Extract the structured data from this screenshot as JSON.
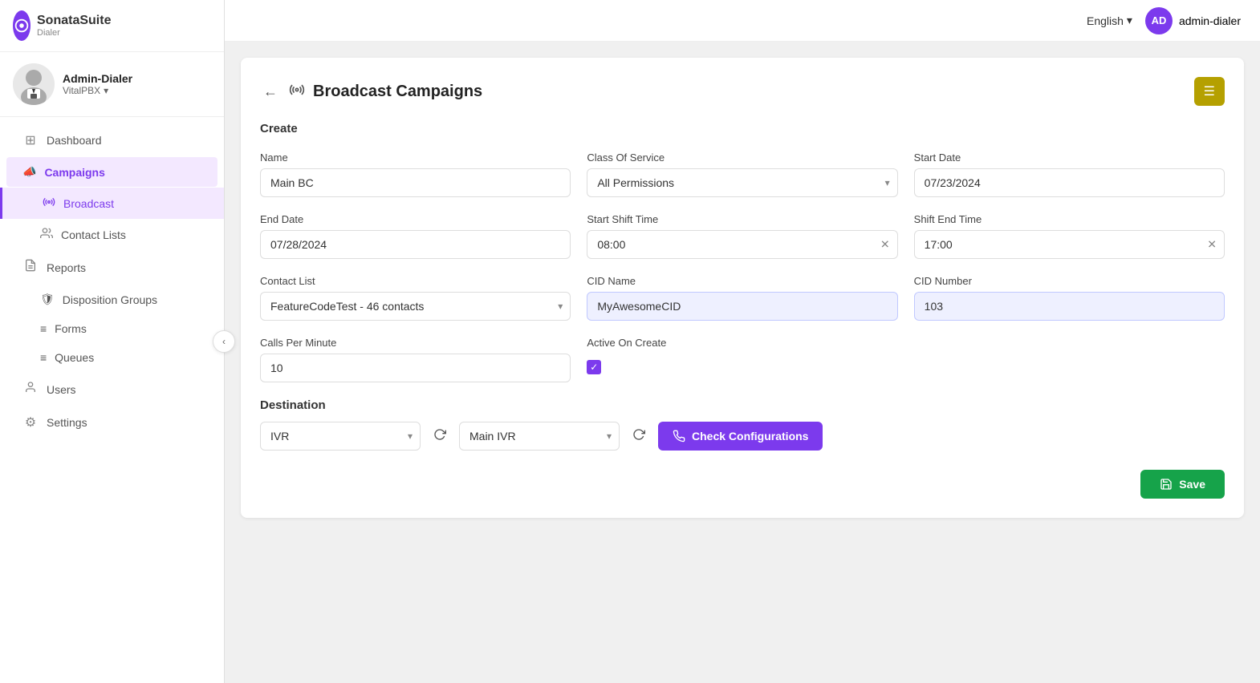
{
  "topbar": {
    "language": "English",
    "user_initials": "AD",
    "user_name": "admin-dialer"
  },
  "sidebar": {
    "logo_text": "SonataSuite",
    "logo_sub": "Dialer",
    "user_name": "Admin-Dialer",
    "user_org": "VitalPBX",
    "nav_items": [
      {
        "id": "dashboard",
        "label": "Dashboard",
        "icon": "⊞"
      },
      {
        "id": "campaigns",
        "label": "Campaigns",
        "icon": "📣",
        "active": true
      },
      {
        "id": "broadcast",
        "label": "Broadcast",
        "icon": "📡",
        "sub": true,
        "active_sub": true
      },
      {
        "id": "contact-lists",
        "label": "Contact Lists",
        "icon": "👥",
        "sub": true
      },
      {
        "id": "reports",
        "label": "Reports",
        "icon": "📄"
      },
      {
        "id": "disposition-groups",
        "label": "Disposition Groups",
        "icon": "🛡",
        "sub": true
      },
      {
        "id": "forms",
        "label": "Forms",
        "icon": "≡",
        "sub": true
      },
      {
        "id": "queues",
        "label": "Queues",
        "icon": "≡",
        "sub": true
      },
      {
        "id": "users",
        "label": "Users",
        "icon": "👤"
      },
      {
        "id": "settings",
        "label": "Settings",
        "icon": "⚙"
      }
    ]
  },
  "page": {
    "title": "Broadcast Campaigns",
    "section_label": "Create",
    "form": {
      "name_label": "Name",
      "name_value": "Main BC",
      "class_of_service_label": "Class Of Service",
      "class_of_service_value": "All Permissions",
      "start_date_label": "Start Date",
      "start_date_value": "07/23/2024",
      "end_date_label": "End Date",
      "end_date_value": "07/28/2024",
      "start_shift_time_label": "Start Shift Time",
      "start_shift_time_value": "08:00",
      "shift_end_time_label": "Shift End Time",
      "shift_end_time_value": "17:00",
      "contact_list_label": "Contact List",
      "contact_list_value": "FeatureCodeTest - 46 contacts",
      "cid_name_label": "CID Name",
      "cid_name_value": "MyAwesomeCID",
      "cid_number_label": "CID Number",
      "cid_number_value": "103",
      "calls_per_minute_label": "Calls Per Minute",
      "calls_per_minute_value": "10",
      "active_on_create_label": "Active On Create",
      "destination_label": "Destination",
      "dest_type_value": "IVR",
      "dest_name_value": "Main IVR",
      "check_config_btn": "Check Configurations",
      "save_btn": "Save"
    }
  }
}
